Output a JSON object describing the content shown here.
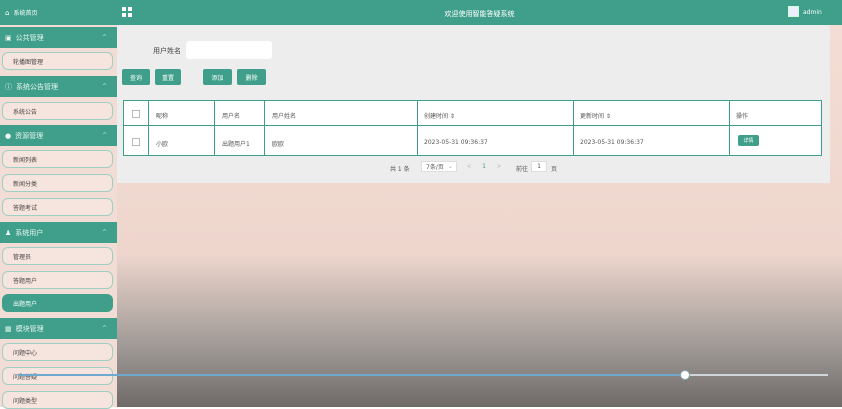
{
  "sidebar": {
    "home": {
      "label": "系统首页",
      "icon": "home-icon"
    },
    "groups": [
      {
        "label": "公共管理",
        "icon": "image-icon",
        "items": [
          {
            "label": "轮播图管理"
          }
        ]
      },
      {
        "label": "系统公告管理",
        "icon": "info-icon",
        "items": [
          {
            "label": "系统公告"
          }
        ]
      },
      {
        "label": "资源管理",
        "icon": "pin-icon",
        "items": [
          {
            "label": "新闻列表"
          },
          {
            "label": "新闻分类"
          },
          {
            "label": "答题考试"
          }
        ]
      },
      {
        "label": "系统用户",
        "icon": "user-icon",
        "items": [
          {
            "label": "管理员"
          },
          {
            "label": "答题用户"
          },
          {
            "label": "出题用户"
          }
        ]
      },
      {
        "label": "模块管理",
        "icon": "grid-icon",
        "items": [
          {
            "label": "问题中心"
          },
          {
            "label": "问题答疑"
          },
          {
            "label": "问题类型"
          }
        ]
      }
    ],
    "active_item": "出题用户"
  },
  "topbar": {
    "title": "欢迎使用智能答疑系统",
    "username": "admin"
  },
  "search": {
    "label": "用户姓名",
    "value": "",
    "placeholder": ""
  },
  "toolbar": {
    "query_label": "查询",
    "reset_label": "重置",
    "add_label": "添加",
    "delete_label": "删除"
  },
  "table": {
    "columns": [
      "昵称",
      "用户名",
      "用户姓名",
      "创建时间 ⇕",
      "更新时间 ⇕",
      "操作"
    ],
    "rows": [
      {
        "nickname": "小欧",
        "username": "出题用户1",
        "realname": "欧欧",
        "created": "2023-05-31 09:36:37",
        "updated": "2023-05-31 09:36:37",
        "action": "详情"
      }
    ]
  },
  "pagination": {
    "total": "共 1 条",
    "page_size": "7条/页",
    "prev": "<",
    "current": "1",
    "next": ">",
    "goto_label": "前往",
    "goto_value": "1",
    "page_unit": "页"
  },
  "video": {
    "progress": 0.823,
    "time_elapsed": "",
    "time_total": ""
  },
  "colors": {
    "accent": "#3f9f8a",
    "sidebar_bg": "#f2ddd6",
    "panel_bg": "#ededed"
  }
}
